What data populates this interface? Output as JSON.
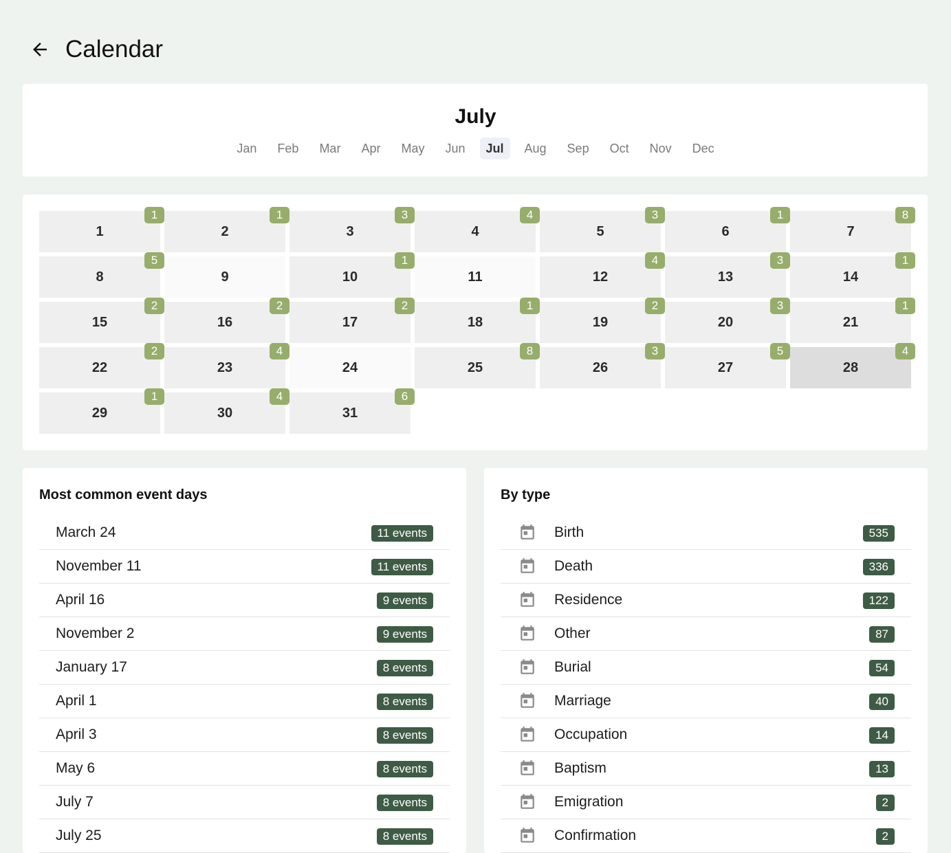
{
  "header": {
    "title": "Calendar"
  },
  "month_selector": {
    "current_month": "July",
    "months": [
      "Jan",
      "Feb",
      "Mar",
      "Apr",
      "May",
      "Jun",
      "Jul",
      "Aug",
      "Sep",
      "Oct",
      "Nov",
      "Dec"
    ],
    "active_index": 6
  },
  "days": [
    {
      "day": "1",
      "count": "1"
    },
    {
      "day": "2",
      "count": "1"
    },
    {
      "day": "3",
      "count": "3"
    },
    {
      "day": "4",
      "count": "4"
    },
    {
      "day": "5",
      "count": "3"
    },
    {
      "day": "6",
      "count": "1"
    },
    {
      "day": "7",
      "count": "8"
    },
    {
      "day": "8",
      "count": "5"
    },
    {
      "day": "9",
      "count": ""
    },
    {
      "day": "10",
      "count": "1"
    },
    {
      "day": "11",
      "count": ""
    },
    {
      "day": "12",
      "count": "4"
    },
    {
      "day": "13",
      "count": "3"
    },
    {
      "day": "14",
      "count": "1"
    },
    {
      "day": "15",
      "count": "2"
    },
    {
      "day": "16",
      "count": "2"
    },
    {
      "day": "17",
      "count": "2"
    },
    {
      "day": "18",
      "count": "1"
    },
    {
      "day": "19",
      "count": "2"
    },
    {
      "day": "20",
      "count": "3"
    },
    {
      "day": "21",
      "count": "1"
    },
    {
      "day": "22",
      "count": "2"
    },
    {
      "day": "23",
      "count": "4"
    },
    {
      "day": "24",
      "count": ""
    },
    {
      "day": "25",
      "count": "8"
    },
    {
      "day": "26",
      "count": "3"
    },
    {
      "day": "27",
      "count": "5"
    },
    {
      "day": "28",
      "count": "4"
    },
    {
      "day": "29",
      "count": "1"
    },
    {
      "day": "30",
      "count": "4"
    },
    {
      "day": "31",
      "count": "6"
    }
  ],
  "highlighted_day": "28",
  "common_days": {
    "title": "Most common event days",
    "items": [
      {
        "label": "March 24",
        "count": "11 events"
      },
      {
        "label": "November 11",
        "count": "11 events"
      },
      {
        "label": "April 16",
        "count": "9 events"
      },
      {
        "label": "November 2",
        "count": "9 events"
      },
      {
        "label": "January 17",
        "count": "8 events"
      },
      {
        "label": "April 1",
        "count": "8 events"
      },
      {
        "label": "April 3",
        "count": "8 events"
      },
      {
        "label": "May 6",
        "count": "8 events"
      },
      {
        "label": "July 7",
        "count": "8 events"
      },
      {
        "label": "July 25",
        "count": "8 events"
      }
    ]
  },
  "by_type": {
    "title": "By type",
    "icon": "calendar-icon",
    "items": [
      {
        "label": "Birth",
        "count": "535"
      },
      {
        "label": "Death",
        "count": "336"
      },
      {
        "label": "Residence",
        "count": "122"
      },
      {
        "label": "Other",
        "count": "87"
      },
      {
        "label": "Burial",
        "count": "54"
      },
      {
        "label": "Marriage",
        "count": "40"
      },
      {
        "label": "Occupation",
        "count": "14"
      },
      {
        "label": "Baptism",
        "count": "13"
      },
      {
        "label": "Emigration",
        "count": "2"
      },
      {
        "label": "Confirmation",
        "count": "2"
      }
    ]
  },
  "colors": {
    "background": "#eff3ef",
    "day_badge": "#97ad6b",
    "count_badge": "#3e5b45",
    "active_tab": "#edf1f7"
  }
}
